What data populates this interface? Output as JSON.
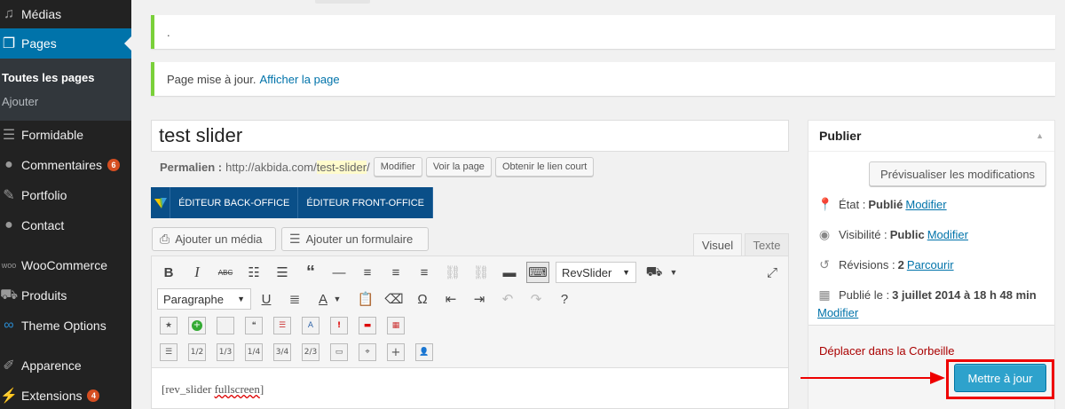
{
  "sidebar": {
    "items": [
      {
        "label": "Médias",
        "icon": "media-icon"
      },
      {
        "label": "Pages",
        "icon": "pages-icon"
      },
      {
        "label": "Formidable",
        "icon": "formidable-icon"
      },
      {
        "label": "Commentaires",
        "icon": "comments-icon",
        "badge": "6"
      },
      {
        "label": "Portfolio",
        "icon": "pin-icon"
      },
      {
        "label": "Contact",
        "icon": "contact-icon"
      },
      {
        "label": "WooCommerce",
        "icon": "woocommerce-icon"
      },
      {
        "label": "Produits",
        "icon": "cart-icon"
      },
      {
        "label": "Theme Options",
        "icon": "infinity-icon"
      },
      {
        "label": "Apparence",
        "icon": "brush-icon"
      },
      {
        "label": "Extensions",
        "icon": "plugin-icon",
        "badge": "4"
      }
    ],
    "submenu": [
      "Toutes les pages",
      "Ajouter"
    ]
  },
  "notices": {
    "first": ".",
    "second_text": "Page mise à jour.",
    "second_link": "Afficher la page"
  },
  "editor": {
    "title": "test slider",
    "permalink_label": "Permalien :",
    "permalink_base": "http://akbida.com/",
    "permalink_slug": "test-slider",
    "permalink_end": "/",
    "btn_modify": "Modifier",
    "btn_view": "Voir la page",
    "btn_shortlink": "Obtenir le lien court",
    "vc_backend": "ÉDITEUR BACK-OFFICE",
    "vc_frontend": "ÉDITEUR FRONT-OFFICE",
    "add_media": "Ajouter un média",
    "add_form": "Ajouter un formulaire",
    "tab_visual": "Visuel",
    "tab_text": "Texte",
    "revslider_select": "RevSlider",
    "format_select": "Paragraphe",
    "content_prefix": "[rev_slider ",
    "content_err": "fullscreen",
    "content_suffix": "]",
    "fraction_buttons": [
      "1/2",
      "1/3",
      "1/4",
      "3/4",
      "2/3"
    ]
  },
  "publish": {
    "title": "Publier",
    "preview_btn": "Prévisualiser les modifications",
    "status_label": "État :",
    "status_value": "Publié",
    "status_link": "Modifier",
    "visibility_label": "Visibilité :",
    "visibility_value": "Public",
    "visibility_link": "Modifier",
    "revisions_label": "Révisions :",
    "revisions_value": "2",
    "revisions_link": "Parcourir",
    "published_label": "Publié le :",
    "published_value": "3 juillet 2014 à 18 h 48 min",
    "published_link": "Modifier",
    "trash_link": "Déplacer dans la Corbeille",
    "update_btn": "Mettre à jour"
  },
  "colors": {
    "accent": "#0073aa",
    "notice_success": "#7ad03a",
    "update_button": "#2ea2cc",
    "highlight": "#e00000"
  }
}
